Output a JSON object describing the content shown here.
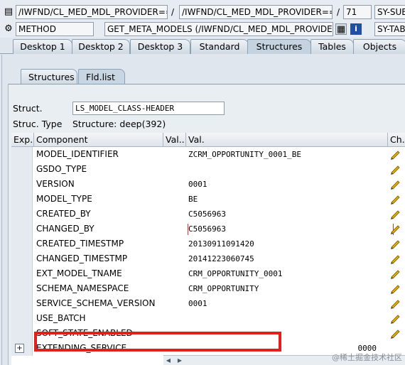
{
  "toolbar": {
    "program_path": "/IWFND/CL_MED_MDL_PROVIDER===",
    "separator": "/",
    "include_path": "/IWFND/CL_MED_MDL_PROVIDER===",
    "line": "71",
    "sysfield_1": "SY-SUB",
    "event_type": "METHOD",
    "event_name": "GET_META_MODELS (/IWFND/CL_MED_MDL_PROVIDER)",
    "sysfield_2": "SY-TAB"
  },
  "main_tabs": [
    "Desktop 1",
    "Desktop 2",
    "Desktop 3",
    "Standard",
    "Structures",
    "Tables",
    "Objects"
  ],
  "sub_tabs": [
    "Structures",
    "Fld.list"
  ],
  "structure": {
    "struct_label": "Struct.",
    "struct_value": "LS_MODEL_CLASS-HEADER",
    "type_label": "Struc. Type",
    "type_value": "Structure: deep(392)"
  },
  "grid": {
    "headers": [
      "Exp.",
      "Component",
      "Val...",
      "Val.",
      "Ch..."
    ],
    "rows": [
      {
        "component": "MODEL_IDENTIFIER",
        "value": "ZCRM_OPPORTUNITY_0001_BE"
      },
      {
        "component": "GSDO_TYPE",
        "value": ""
      },
      {
        "component": "VERSION",
        "value": "0001"
      },
      {
        "component": "MODEL_TYPE",
        "value": "BE"
      },
      {
        "component": "CREATED_BY",
        "value": "C5056963"
      },
      {
        "component": "CHANGED_BY",
        "value": "C5056963"
      },
      {
        "component": "CREATED_TIMESTMP",
        "value": "20130911091420"
      },
      {
        "component": "CHANGED_TIMESTMP",
        "value": "20141223060745"
      },
      {
        "component": "EXT_MODEL_TNAME",
        "value": "CRM_OPPORTUNITY_0001"
      },
      {
        "component": "SCHEMA_NAMESPACE",
        "value": "CRM_OPPORTUNITY"
      },
      {
        "component": "SERVICE_SCHEMA_VERSION",
        "value": "0001"
      },
      {
        "component": "USE_BATCH",
        "value": ""
      },
      {
        "component": "SOFT_STATE_ENABLED",
        "value": ""
      },
      {
        "component": "EXTENDING_SERVICE",
        "value": "0000"
      }
    ]
  },
  "highlight_color": "#e0201e",
  "watermark": "@稀土掘金技术社区"
}
